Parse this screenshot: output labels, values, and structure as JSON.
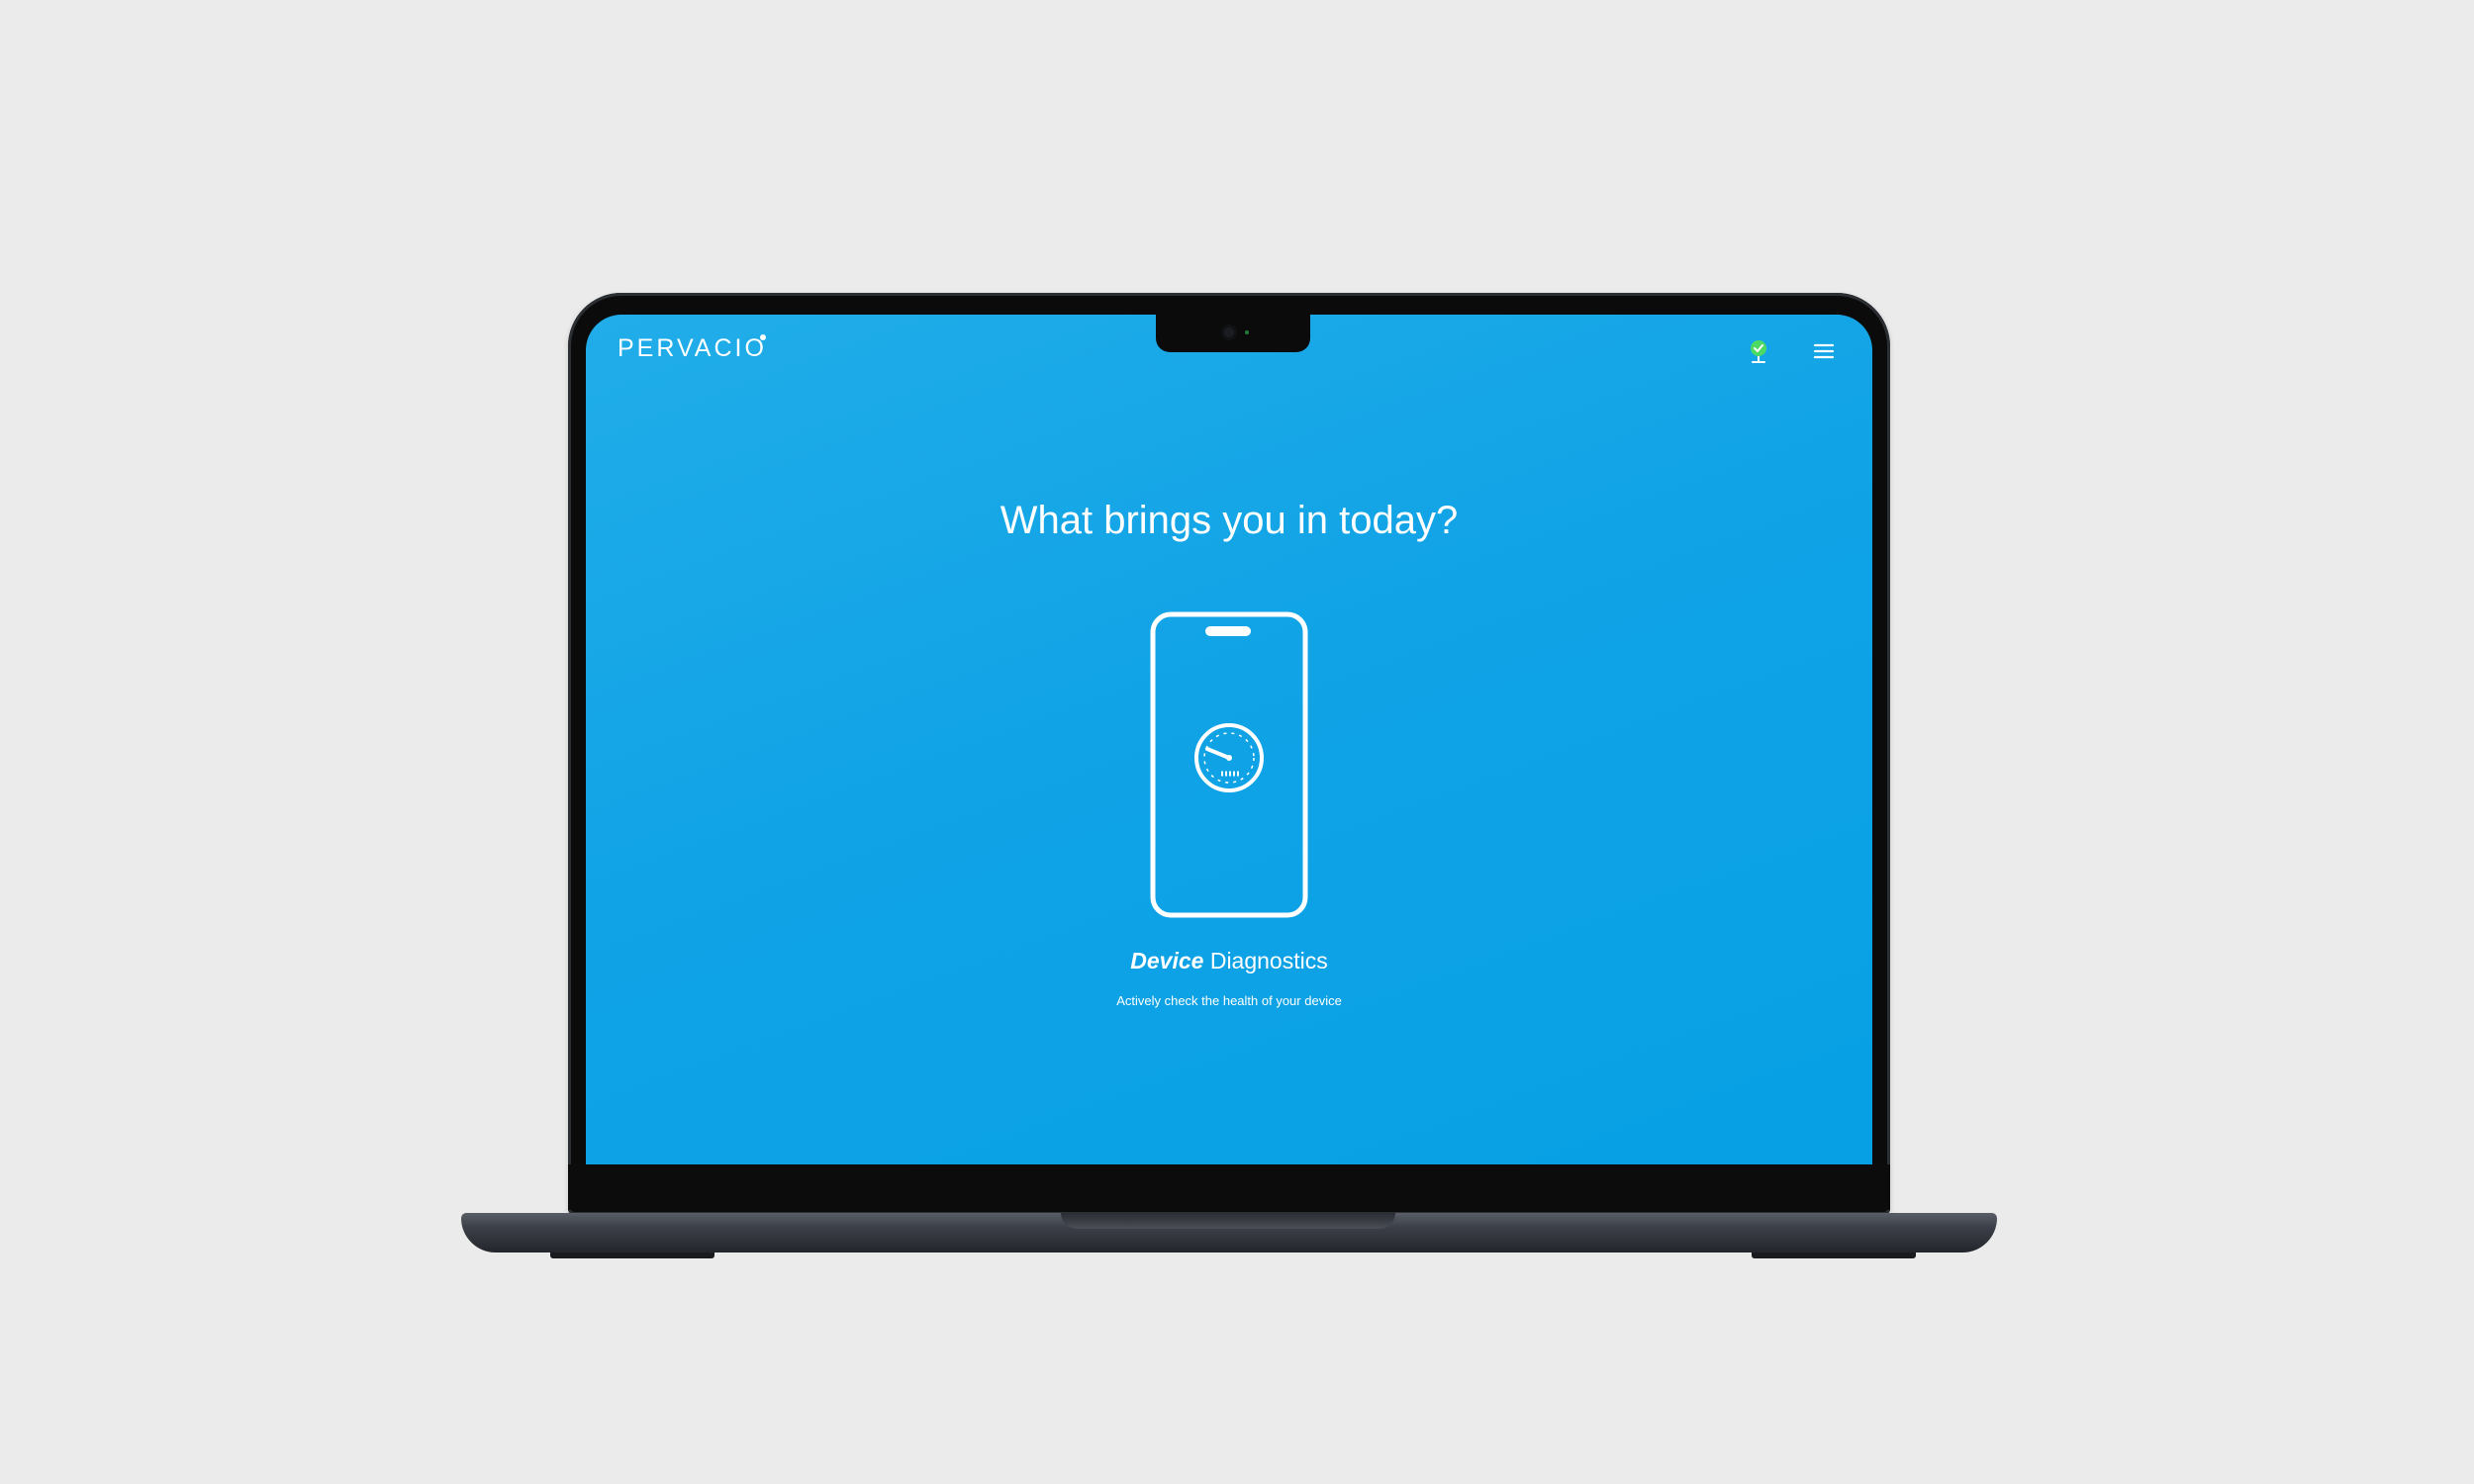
{
  "app": {
    "brand": "PERVACIO"
  },
  "header": {
    "status_icon": "location-check-icon",
    "status_color": "#4cd964",
    "menu_icon": "hamburger-menu-icon"
  },
  "main": {
    "heading": "What brings you in today?",
    "options": [
      {
        "title_bold": "Device",
        "title_rest": " Diagnostics",
        "subtitle": "Actively check the health of your device",
        "icon": "phone-speedometer-icon"
      }
    ]
  },
  "colors": {
    "screen_background": "#0ea3e6",
    "text": "#ffffff",
    "page_background": "#ebebeb"
  }
}
